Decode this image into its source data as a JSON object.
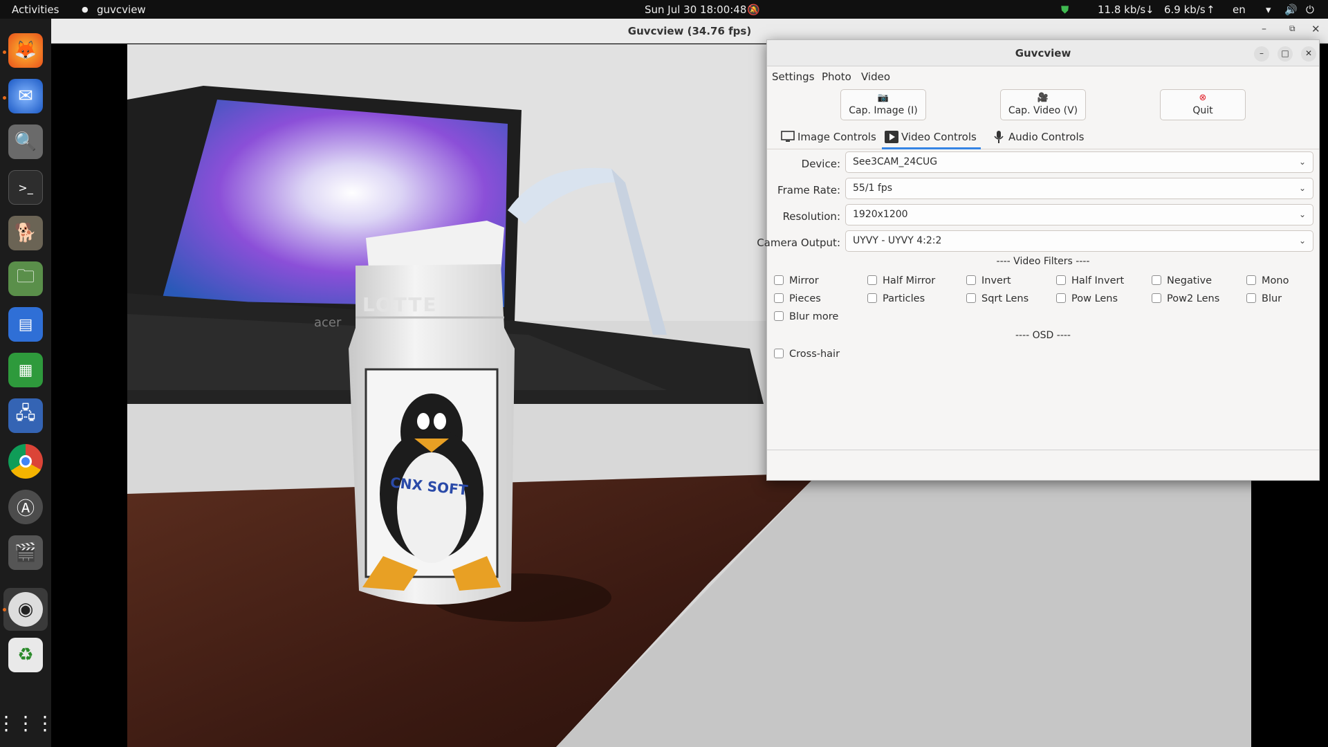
{
  "topbar": {
    "activities": "Activities",
    "app_name": "guvcview",
    "clock": "Sun Jul 30  18:00:48",
    "net_down": "11.8 kb/s",
    "net_up": "6.9 kb/s",
    "lang": "en"
  },
  "dock": {
    "icons": [
      "firefox-icon",
      "thunderbird-icon",
      "search-icon",
      "terminal-icon",
      "gimp-icon",
      "files-icon",
      "writer-icon",
      "calc-icon",
      "remote-desktop-icon",
      "chrome-icon",
      "software-icon",
      "inkscape-icon",
      "webcam-icon",
      "trash-icon",
      "app-grid-icon"
    ]
  },
  "video_window": {
    "title": "Guvcview  (34.76 fps)",
    "scene": {
      "bottle_text_top": "LOTTE",
      "bottle_text_mid": "CNX SOFT",
      "laptop_brand": "acer"
    }
  },
  "panel": {
    "title": "Guvcview",
    "menu": [
      "Settings",
      "Photo",
      "Video"
    ],
    "toolbar": {
      "cap_image": "Cap. Image (I)",
      "cap_video": "Cap. Video (V)",
      "quit": "Quit"
    },
    "tabs": {
      "image": "Image Controls",
      "video": "Video Controls",
      "audio": "Audio Controls"
    },
    "fields": {
      "device_label": "Device:",
      "device_value": "See3CAM_24CUG",
      "framerate_label": "Frame Rate:",
      "framerate_value": "55/1 fps",
      "resolution_label": "Resolution:",
      "resolution_value": "1920x1200",
      "output_label": "Camera Output:",
      "output_value": "UYVY - UYVY 4:2:2"
    },
    "video_filters_title": "---- Video Filters ----",
    "filters": [
      "Mirror",
      "Half Mirror",
      "Invert",
      "Half Invert",
      "Negative",
      "Mono",
      "Pieces",
      "Particles",
      "Sqrt Lens",
      "Pow Lens",
      "Pow2 Lens",
      "Blur",
      "Blur more"
    ],
    "osd_title": "---- OSD ----",
    "osd": [
      "Cross-hair"
    ]
  }
}
